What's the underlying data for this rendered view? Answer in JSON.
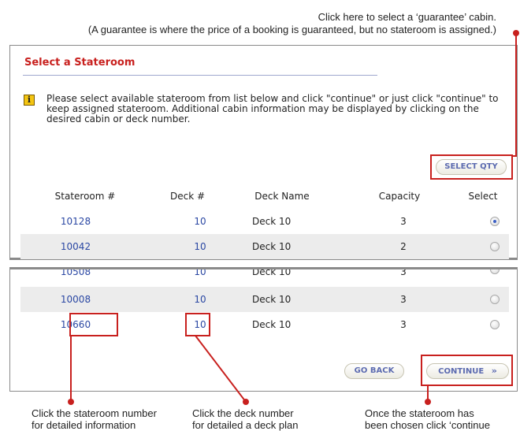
{
  "annotations": {
    "top_line1": "Click here to select a ‘guarantee’ cabin.",
    "top_line2": "(A guarantee is where the price of a booking is guaranteed, but no stateroom is assigned.)",
    "bottom_left_1": "Click the stateroom number",
    "bottom_left_2": "for detailed information",
    "bottom_mid_1": "Click the deck number",
    "bottom_mid_2": "for detailed a deck plan",
    "bottom_right_1": "Once the stateroom has",
    "bottom_right_2": "been chosen click ‘continue"
  },
  "page": {
    "title": "Select a Stateroom",
    "info_icon": "info-icon",
    "instructions": "Please select available stateroom from list below and click \"continue\" or just click \"continue\" to keep assigned stateroom. Additional cabin information may be displayed by clicking on the desired cabin or deck number."
  },
  "buttons": {
    "select_qty": "SELECT QTY",
    "go_back": "GO BACK",
    "continue": "CONTINUE",
    "continue_icon": "double-chevron-right-icon"
  },
  "table": {
    "headers": {
      "stateroom": "Stateroom #",
      "deck": "Deck #",
      "deck_name": "Deck Name",
      "capacity": "Capacity",
      "select": "Select"
    },
    "rows_top": [
      {
        "stateroom": "10128",
        "deck": "10",
        "deck_name": "Deck 10",
        "capacity": "3",
        "selected": true
      },
      {
        "stateroom": "10042",
        "deck": "10",
        "deck_name": "Deck 10",
        "capacity": "2",
        "selected": false
      }
    ],
    "rows_bottom": [
      {
        "stateroom": "10508",
        "deck": "10",
        "deck_name": "Deck 10",
        "capacity": "3",
        "selected": false
      },
      {
        "stateroom": "10008",
        "deck": "10",
        "deck_name": "Deck 10",
        "capacity": "3",
        "selected": false
      },
      {
        "stateroom": "10660",
        "deck": "10",
        "deck_name": "Deck 10",
        "capacity": "3",
        "selected": false
      }
    ]
  },
  "colors": {
    "accent_red": "#c8201e",
    "link_blue": "#2a47a3",
    "button_text": "#5c6bb0"
  }
}
